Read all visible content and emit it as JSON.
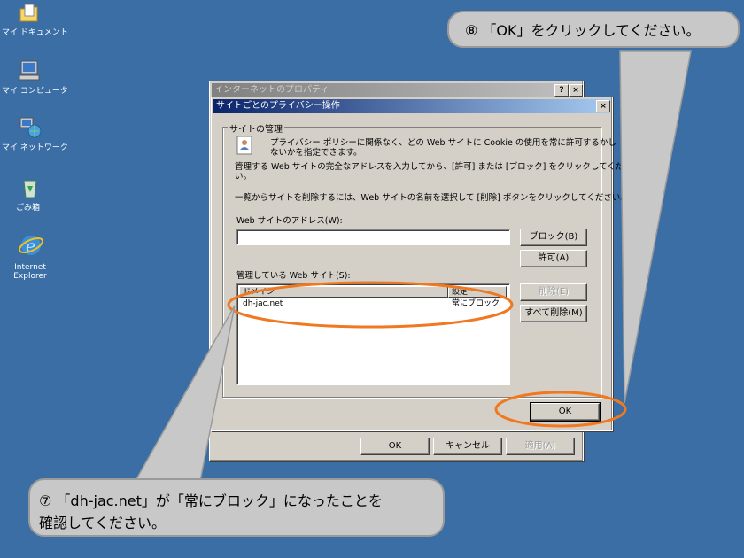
{
  "desktop": {
    "icons": [
      {
        "label": "マイ ドキュメント",
        "icon": "my-documents-icon"
      },
      {
        "label": "マイ コンピュータ",
        "icon": "my-computer-icon"
      },
      {
        "label": "マイ ネットワーク",
        "icon": "my-network-icon"
      },
      {
        "label": "ごみ箱",
        "icon": "recycle-bin-icon"
      },
      {
        "label": "Internet Explorer",
        "icon": "internet-explorer-icon"
      }
    ]
  },
  "parent_window": {
    "title": "インターネットのプロパティ",
    "help_btn": "?",
    "close_btn": "×",
    "ok": "OK",
    "cancel": "キャンセル",
    "apply": "適用(A)"
  },
  "dialog": {
    "title": "サイトごとのプライバシー操作",
    "close_btn": "×",
    "group_label": "サイトの管理",
    "intro_line1": "プライバシー ポリシーに関係なく、どの Web サイトに Cookie の使用を常に許可するかし",
    "intro_line2": "ないかを指定できます。",
    "instr_line1": "管理する Web サイトの完全なアドレスを入力してから、[許可] または [ブロック] をクリックしてくださ",
    "instr_line2": "い。",
    "remove_instr": "一覧からサイトを削除するには、Web サイトの名前を選択して [削除] ボタンをクリックしてください。",
    "address_label": "Web サイトのアドレス(W):",
    "address_value": "",
    "block_btn": "ブロック(B)",
    "allow_btn": "許可(A)",
    "managed_label": "管理している Web サイト(S):",
    "col_domain": "ドメイン",
    "col_setting": "設定",
    "rows": [
      {
        "domain": "dh-jac.net",
        "setting": "常にブロック"
      }
    ],
    "remove_btn": "削除(E)",
    "remove_all_btn": "すべて削除(M)",
    "ok_btn": "OK"
  },
  "callouts": {
    "step8": "⑧ 「OK」をクリックしてください。",
    "step7_line1": "⑦ 「dh-jac.net」が「常にブロック」になったことを",
    "step7_line2": "確認してください。"
  },
  "colors": {
    "desktop": "#3a6ea5",
    "highlight": "#f07820",
    "callout_bg": "#c8c8c8"
  }
}
